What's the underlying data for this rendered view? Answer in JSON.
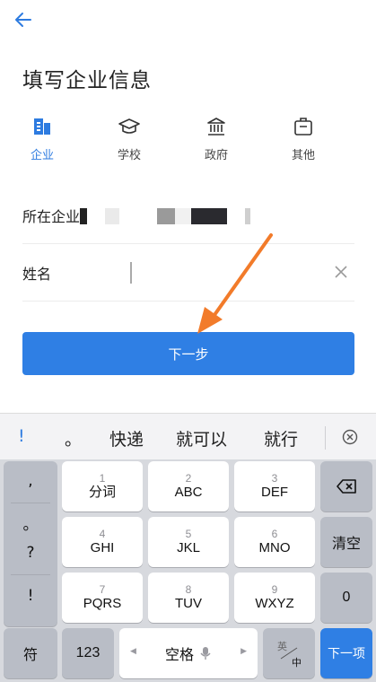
{
  "title": "填写企业信息",
  "org_types": [
    {
      "label": "企业",
      "icon": "enterprise-icon",
      "active": true
    },
    {
      "label": "学校",
      "icon": "school-icon",
      "active": false
    },
    {
      "label": "政府",
      "icon": "government-icon",
      "active": false
    },
    {
      "label": "其他",
      "icon": "other-icon",
      "active": false
    }
  ],
  "form": {
    "company_label": "所在企业",
    "name_label": "姓名",
    "next_button": "下一步"
  },
  "colors": {
    "accent": "#2f7fe4",
    "arrow": "#f27b2a"
  },
  "keyboard": {
    "candidates": [
      "!",
      "。",
      "快递",
      "就可以",
      "就行"
    ],
    "symbols": [
      ",",
      "。",
      "?",
      "!"
    ],
    "keys": [
      {
        "num": "1",
        "letters": "分词"
      },
      {
        "num": "2",
        "letters": "ABC"
      },
      {
        "num": "3",
        "letters": "DEF"
      },
      {
        "num": "4",
        "letters": "GHI"
      },
      {
        "num": "5",
        "letters": "JKL"
      },
      {
        "num": "6",
        "letters": "MNO"
      },
      {
        "num": "7",
        "letters": "PQRS"
      },
      {
        "num": "8",
        "letters": "TUV"
      },
      {
        "num": "9",
        "letters": "WXYZ"
      }
    ],
    "clear": "清空",
    "zero": "0",
    "symbol_key": "符",
    "num_key": "123",
    "space": "空格",
    "lang_top": "英",
    "lang_bottom": "中",
    "next_item": "下一项"
  }
}
